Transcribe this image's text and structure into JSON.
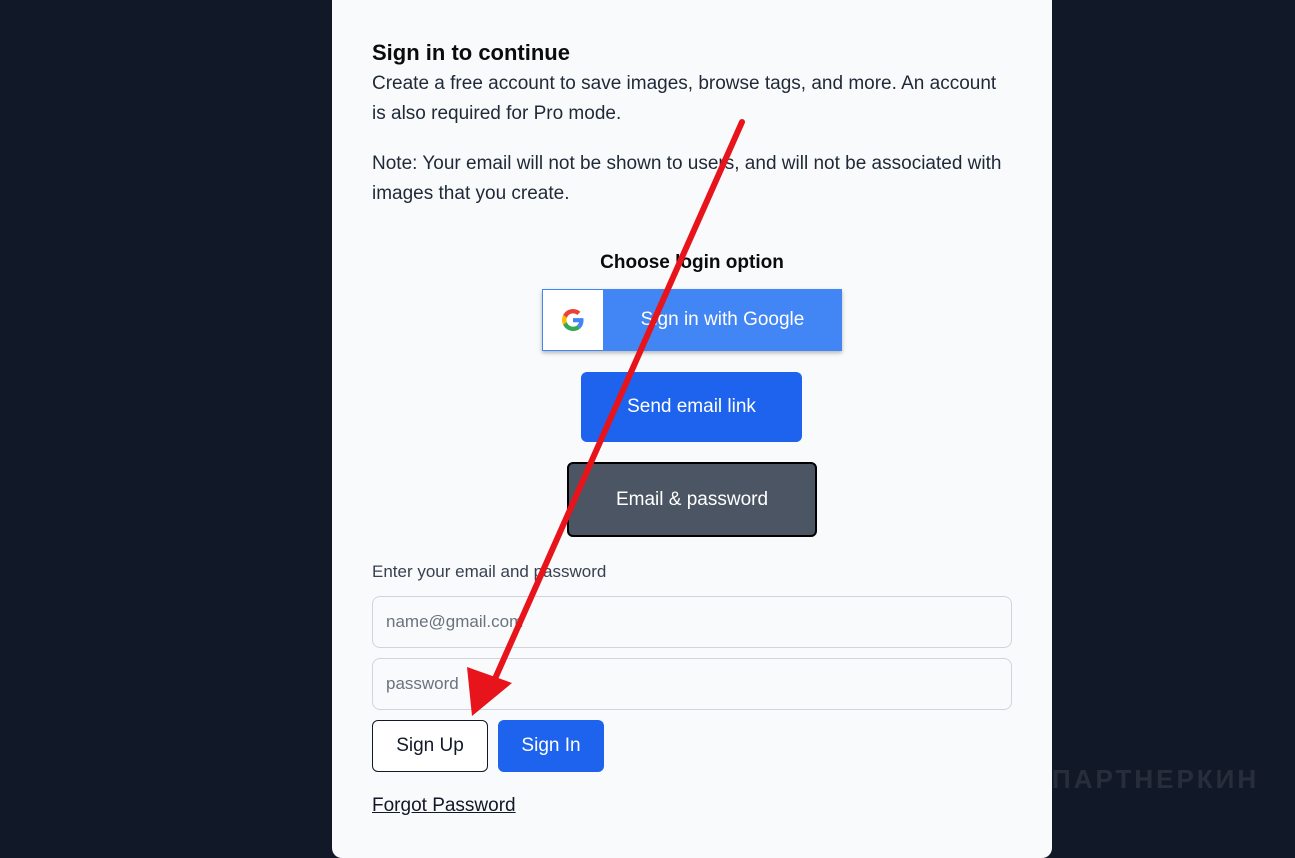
{
  "dialog": {
    "title": "Sign in to continue",
    "description": "Create a free account to save images, browse tags, and more. An account is also required for Pro mode.",
    "note": "Note: Your email will not be shown to users, and will not be associated with images that you create.",
    "choose_label": "Choose login option"
  },
  "login_options": {
    "google_label": "Sign in with Google",
    "email_link_label": "Send email link",
    "email_password_label": "Email & password"
  },
  "form": {
    "label": "Enter your email and password",
    "email_placeholder": "name@gmail.com",
    "password_placeholder": "password",
    "signup_label": "Sign Up",
    "signin_label": "Sign In",
    "forgot_label": "Forgot Password"
  },
  "watermark": {
    "text": "ПАРТНЕРКИН"
  },
  "colors": {
    "primary_blue": "#1d63ed",
    "google_blue": "#4285f4",
    "selected_gray": "#4b5563",
    "annotation_arrow": "#e8141c",
    "background": "#111827"
  },
  "icons": {
    "google": "google-g-icon",
    "annotation": "red-arrow-annotation"
  }
}
